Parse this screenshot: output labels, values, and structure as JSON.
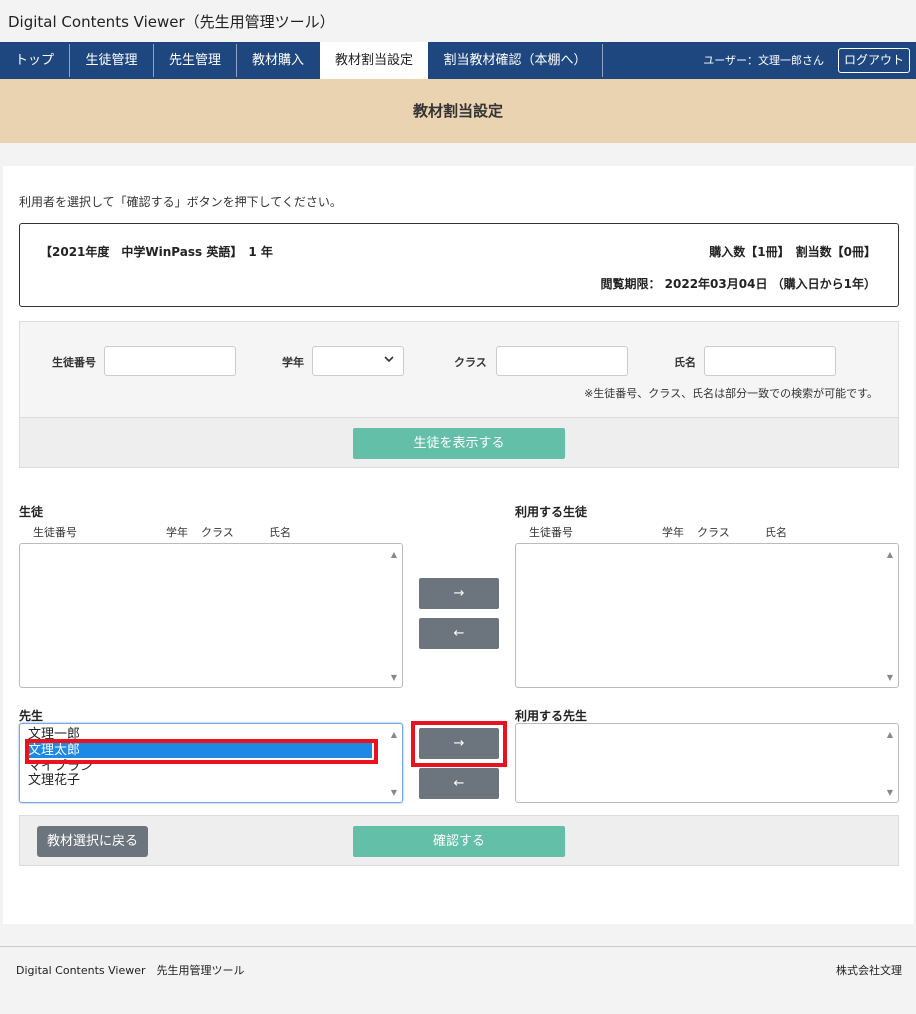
{
  "app": {
    "title": "Digital Contents Viewer（先生用管理ツール）"
  },
  "nav": {
    "items": [
      {
        "label": "トップ"
      },
      {
        "label": "生徒管理"
      },
      {
        "label": "先生管理"
      },
      {
        "label": "教材購入"
      },
      {
        "label": "教材割当設定"
      },
      {
        "label": "割当教材確認（本棚へ）"
      }
    ],
    "active": "教材割当設定",
    "user": "ユーザー：文理一郎さん",
    "logout": "ログアウト"
  },
  "header": {
    "title": "教材割当設定"
  },
  "instruction": "利用者を選択して「確認する」ボタンを押下してください。",
  "info": {
    "title": "【2021年度　中学WinPass 英語】　1 年",
    "counts": "購入数【1冊】　割当数【0冊】",
    "period": "閲覧期限：  2022年03月04日 （購入日から1年）"
  },
  "search": {
    "student_no_label": "生徒番号",
    "grade_label": "学年",
    "class_label": "クラス",
    "name_label": "氏名",
    "grade_value": "",
    "note": "※生徒番号、クラス、氏名は部分一致での検索が可能です。",
    "show_button": "生徒を表示する"
  },
  "students": {
    "label": "生徒",
    "columns": [
      "生徒番号",
      "学年",
      "クラス",
      "氏名"
    ],
    "items": []
  },
  "using_students": {
    "label": "利用する生徒",
    "columns": [
      "生徒番号",
      "学年",
      "クラス",
      "氏名"
    ],
    "items": []
  },
  "teachers": {
    "label": "先生",
    "items": [
      "文理一郎",
      "文理太郎",
      "マイプラン",
      "文理花子"
    ],
    "selected_index": 1
  },
  "using_teachers": {
    "label": "利用する先生",
    "items": []
  },
  "move_buttons": {
    "right": "→",
    "left": "←"
  },
  "actions": {
    "back": "教材選択に戻る",
    "confirm": "確認する"
  },
  "footer": {
    "left": "Digital Contents Viewer　先生用管理ツール",
    "right": "株式会社文理"
  },
  "colors": {
    "navbar": "#1e467f",
    "header": "#ead3b1",
    "green_button": "#64bfa8",
    "gray_button": "#6c757d",
    "selection": "#1e88e5",
    "highlight": "#e8131f"
  }
}
